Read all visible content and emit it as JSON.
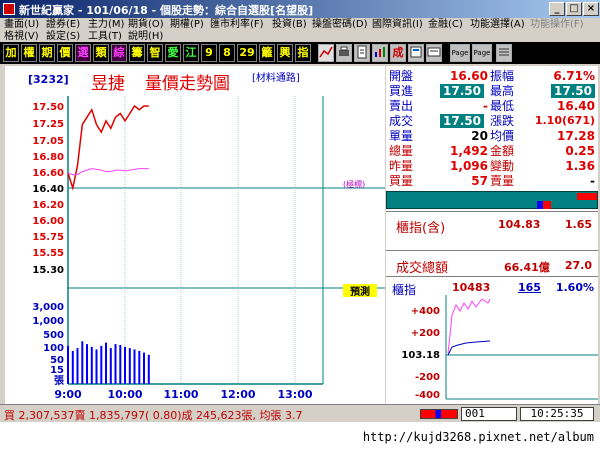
{
  "window": {
    "title": "新世紀贏家 - 101/06/18 - 個股走勢：綜合自選股[名望股]",
    "controls": [
      "_",
      "□",
      "×"
    ]
  },
  "menu1": [
    "畫面(U)",
    "證券(E)",
    "主力(M)",
    "期貨(O)",
    "期權(P)",
    "匯市利率(F)",
    "投資(B)",
    "操盤密碼(D)",
    "國際資訊(I)",
    "金融(C)",
    "功能選擇(A)",
    "功能操作(F)"
  ],
  "menu2": [
    "格視(V)",
    "設定(S)",
    "工具(T)",
    "說明(H)"
  ],
  "toolbar": {
    "buttons": [
      "加",
      "權",
      "期",
      "價",
      "選",
      "類",
      "綜",
      "籌",
      "智",
      "愛",
      "江",
      "9",
      "8",
      "29",
      "籬",
      "興",
      "指"
    ],
    "icons": [
      "graph-icon",
      "print-icon",
      "note-icon",
      "chart-icon",
      "tick-icon",
      "page-icon",
      "news-icon",
      "page-up-icon",
      "page-down-icon",
      "list-icon"
    ],
    "icon_labels": [
      "",
      "",
      "",
      "",
      "成",
      "",
      "",
      "Page",
      "Page",
      ""
    ]
  },
  "stock": {
    "code": "[3232]",
    "name": "昱捷",
    "chart_title": "量價走勢圖",
    "category": "[材料通路]"
  },
  "price_axis": [
    "17.50",
    "17.25",
    "17.05",
    "16.80",
    "16.60",
    "16.40",
    "16.20",
    "16.00",
    "15.75",
    "15.55",
    "15.30"
  ],
  "volume_axis": [
    "3,000",
    "1,000",
    "500",
    "100",
    "50",
    "15",
    "張"
  ],
  "time_axis": [
    "9:00",
    "10:00",
    "11:00",
    "12:00",
    "13:00"
  ],
  "limit_down_label": "(極標)",
  "avg_tag": "預測",
  "quote": {
    "rows": [
      {
        "l1": "開盤",
        "v1": "16.60",
        "l2": "振幅",
        "v2": "6.71%"
      },
      {
        "l1": "買進",
        "v1": "17.50",
        "l2": "最高",
        "v2": "17.50"
      },
      {
        "l1": "賣出",
        "v1": "-",
        "l2": "最低",
        "v2": "16.40"
      },
      {
        "l1": "成交",
        "v1": "17.50",
        "l2": "漲跌",
        "v2": "1.10(671)"
      },
      {
        "l1": "單量",
        "v1": "20",
        "l2": "均價",
        "v2": "17.28"
      },
      {
        "l1": "總量",
        "v1": "1,492",
        "l2": "金額",
        "v2": "0.25"
      },
      {
        "l1": "昨量",
        "v1": "1,096",
        "l2": "變動",
        "v2": "1.36"
      },
      {
        "l1": "買量",
        "v1": "57",
        "l2": "賣量",
        "v2": "-"
      }
    ]
  },
  "index_box": {
    "label": "櫃指(含)",
    "value": "104.83",
    "change": "1.65"
  },
  "total_box": {
    "label": "成交總額",
    "value": "66.41億",
    "change": "27.0"
  },
  "mini": {
    "label": "櫃指",
    "value": "10483",
    "change": "165",
    "pct": "1.60%",
    "axis": [
      "+400",
      "+200",
      "103.18",
      "-200",
      "-400"
    ]
  },
  "status": {
    "text": "買 2,307,537賣 1,835,797( 0.80)成 245,623張, 均張 3.7",
    "code": "001",
    "time": "10:25:35"
  },
  "url": "http://kujd3268.pixnet.net/album",
  "chart_data": [
    {
      "type": "line",
      "title": "量價走勢圖",
      "x": [
        "9:00",
        "9:05",
        "9:10",
        "9:15",
        "9:20",
        "9:25",
        "9:30",
        "9:35",
        "9:40",
        "9:45",
        "9:50",
        "9:55",
        "10:00",
        "10:05",
        "10:10",
        "10:15",
        "10:20",
        "10:25"
      ],
      "series": [
        {
          "name": "",
          "values": [
            16.6,
            16.4,
            16.7,
            17.25,
            17.35,
            17.45,
            17.25,
            17.15,
            17.3,
            17.2,
            17.35,
            17.4,
            17.3,
            17.4,
            17.5,
            17.45,
            17.5,
            17.5
          ]
        },
        {
          "name": "",
          "values": [
            16.6,
            16.58,
            16.58,
            16.62,
            16.64,
            16.66,
            16.65,
            16.64,
            16.62,
            16.62,
            16.64,
            16.64,
            16.63,
            16.64,
            16.65,
            16.66,
            16.66,
            16.66
          ]
        }
      ],
      "ylim": [
        15.3,
        17.5
      ]
    },
    {
      "type": "bar",
      "x": [
        "9:00",
        "9:05",
        "9:10",
        "9:15",
        "9:20",
        "9:25",
        "9:30",
        "9:35",
        "9:40",
        "9:45",
        "9:50",
        "9:55",
        "10:00",
        "10:05",
        "10:10",
        "10:15",
        "10:20",
        "10:25"
      ],
      "values": [
        50,
        30,
        40,
        80,
        60,
        45,
        35,
        50,
        70,
        40,
        60,
        55,
        45,
        40,
        35,
        30,
        25,
        20
      ]
    }
  ]
}
